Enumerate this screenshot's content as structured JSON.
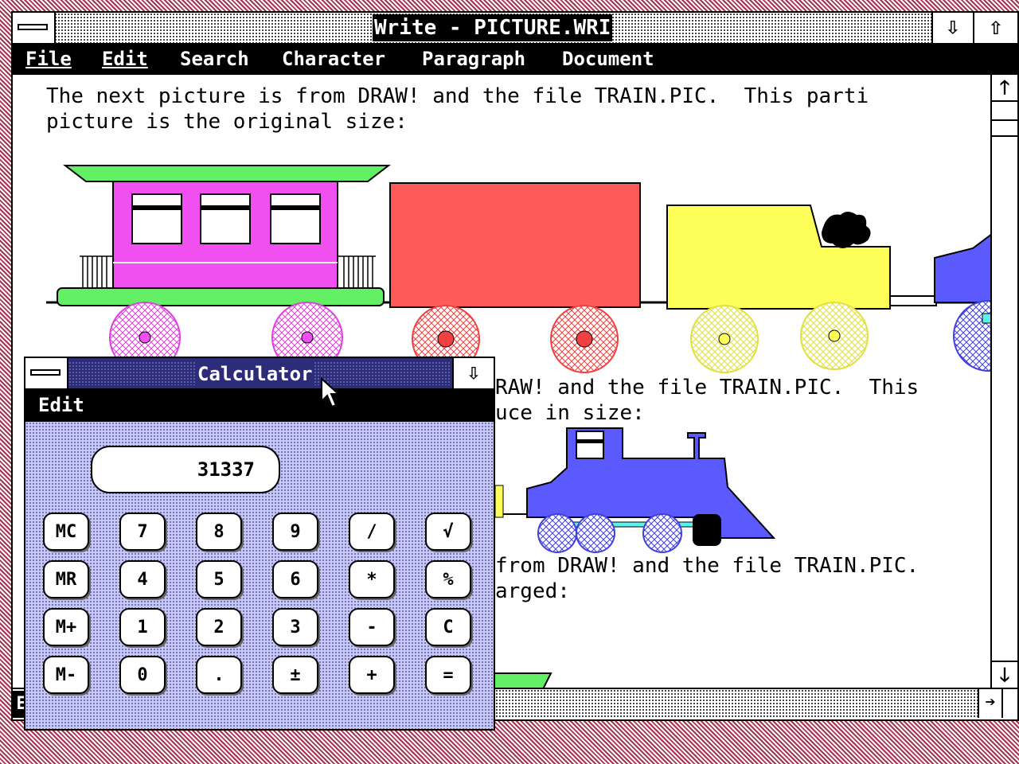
{
  "write": {
    "title": "Write - PICTURE.WRI",
    "menu": [
      "File",
      "Edit",
      "Search",
      "Character",
      "Paragraph",
      "Document"
    ],
    "para1_line1": "The next picture is from DRAW! and the file TRAIN.PIC.  This parti",
    "para1_line2": "picture is the original size:",
    "para2_line1": "RAW! and the file TRAIN.PIC.  This",
    "para2_line2": "uce in size:",
    "para3_line1": "from DRAW! and the file TRAIN.PIC.",
    "para3_line2": "arged:",
    "status_letter": "E"
  },
  "calculator": {
    "title": "Calculator",
    "menu": [
      "Edit"
    ],
    "display": "31337",
    "buttons": [
      [
        "MC",
        "7",
        "8",
        "9",
        "/",
        "√"
      ],
      [
        "MR",
        "4",
        "5",
        "6",
        "*",
        "%"
      ],
      [
        "M+",
        "1",
        "2",
        "3",
        "-",
        "C"
      ],
      [
        "M-",
        "0",
        ".",
        "±",
        "+",
        "="
      ]
    ]
  },
  "icons": [
    "system-menu-icon",
    "minimize-arrow-icon",
    "maximize-arrow-icon",
    "scroll-up-arrow-icon",
    "scroll-down-arrow-icon",
    "scroll-right-arrow-icon",
    "mouse-cursor-icon"
  ],
  "colors": {
    "titlebar": "#000000",
    "calc_title": "#2c2c78",
    "calc_body": "#c8c8f4",
    "desktop": "#a8324f",
    "magenta": "#f050f0",
    "red": "#ff5a5a",
    "yellow": "#ffff5a",
    "blue": "#5a5aff",
    "green": "#64f064"
  }
}
